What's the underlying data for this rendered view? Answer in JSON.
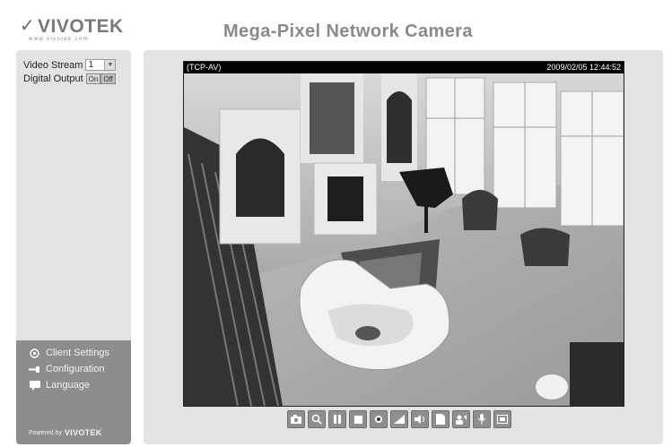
{
  "header": {
    "logo_text": "VIVOTEK",
    "logo_url": "www.vivotek.com",
    "title": "Mega-Pixel Network Camera"
  },
  "sidebar": {
    "video_stream_label": "Video Stream",
    "video_stream_value": "1",
    "digital_output_label": "Digital Output",
    "on_label": "On",
    "off_label": "Off",
    "menu": [
      {
        "label": "Client Settings",
        "icon": "shield-gear-icon"
      },
      {
        "label": "Configuration",
        "icon": "wrench-icon"
      },
      {
        "label": "Language",
        "icon": "speech-bubble-icon"
      }
    ],
    "powered_by": "Powered by",
    "powered_brand": "VIVOTEK"
  },
  "video": {
    "protocol": "(TCP-AV)",
    "timestamp": "2009/02/05 12:44:52"
  },
  "controls": [
    {
      "name": "snapshot-button",
      "icon": "camera-icon"
    },
    {
      "name": "zoom-button",
      "icon": "magnifier-icon"
    },
    {
      "name": "pause-button",
      "icon": "pause-icon"
    },
    {
      "name": "stop-button",
      "icon": "stop-icon"
    },
    {
      "name": "record-button",
      "icon": "record-icon"
    },
    {
      "name": "volume-button",
      "icon": "volume-icon"
    },
    {
      "name": "mute-button",
      "icon": "speaker-icon"
    },
    {
      "name": "file-button",
      "icon": "file-icon"
    },
    {
      "name": "talk-button",
      "icon": "talk-icon"
    },
    {
      "name": "microphone-button",
      "icon": "microphone-icon"
    },
    {
      "name": "fullscreen-button",
      "icon": "fullscreen-icon"
    }
  ]
}
